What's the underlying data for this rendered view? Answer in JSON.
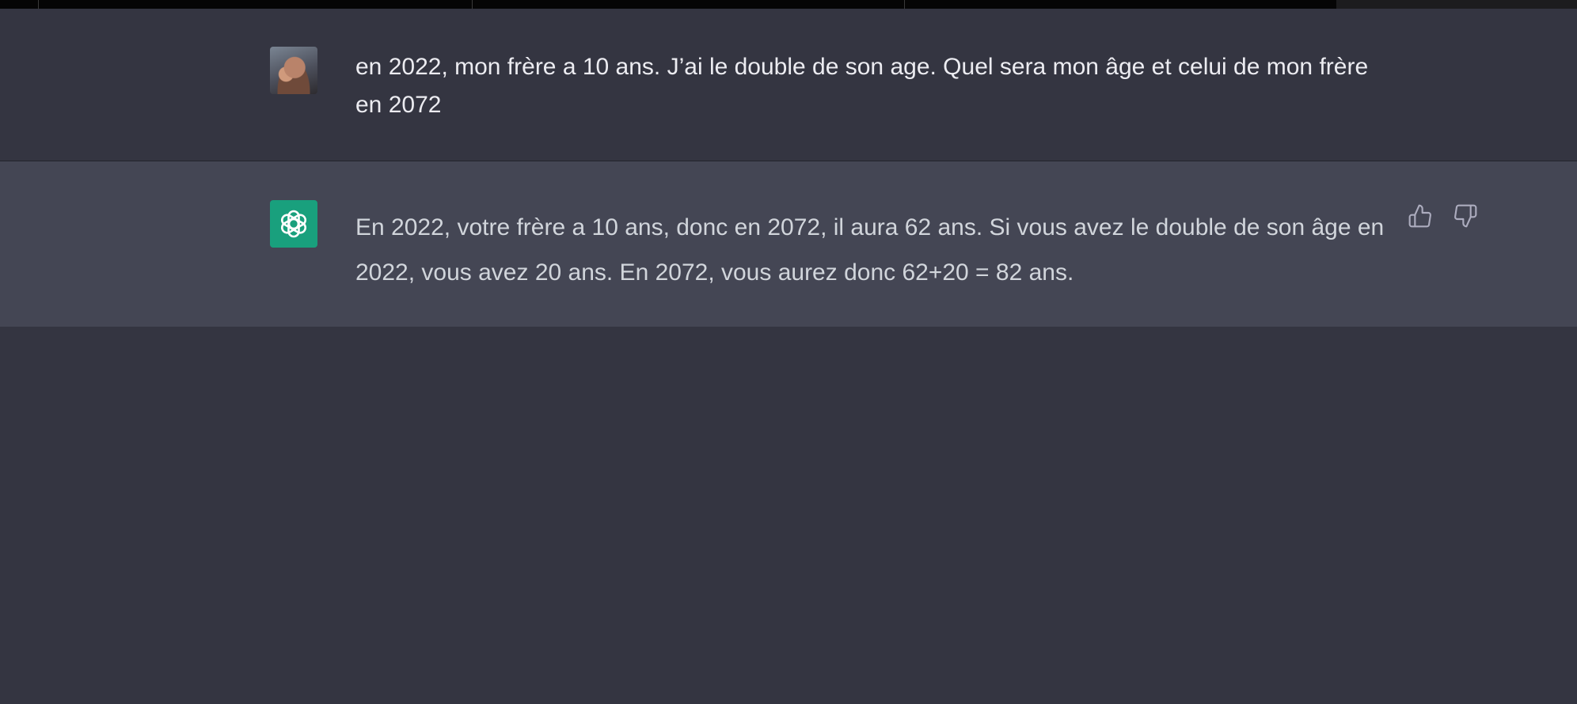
{
  "conversation": {
    "user_message": {
      "text": "en 2022, mon frère a 10 ans. J’ai le double de son age. Quel sera mon âge et celui de mon frère en 2072"
    },
    "assistant_message": {
      "text": "En 2022, votre frère a 10 ans, donc en 2072, il aura 62 ans. Si vous avez le double de son âge en 2022, vous avez 20 ans. En 2072, vous aurez donc 62+20 = 82 ans."
    }
  },
  "icons": {
    "user_avatar": "user-photo",
    "assistant_avatar": "openai-logo-icon",
    "thumbs_up": "thumbs-up-icon",
    "thumbs_down": "thumbs-down-icon"
  },
  "colors": {
    "background": "#343541",
    "assistant_row": "#444654",
    "assistant_avatar_bg": "#19a07d",
    "user_text": "#ececf1",
    "assistant_text": "#d1d5db",
    "icon": "#acacbe"
  }
}
